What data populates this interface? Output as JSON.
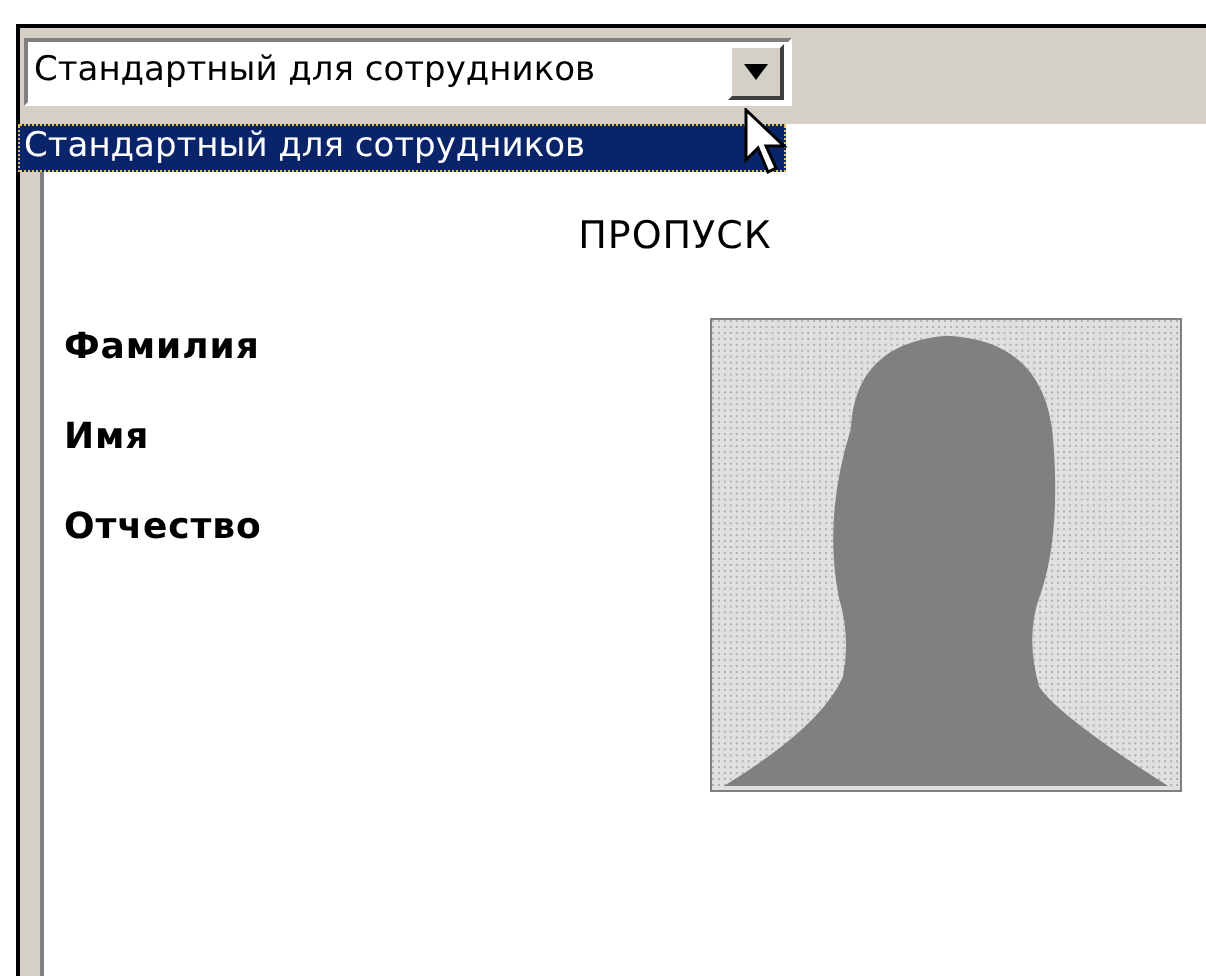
{
  "combo": {
    "value": "Стандартный для сотрудников",
    "options": [
      {
        "label": "Стандартный для сотрудников",
        "selected": true
      }
    ]
  },
  "card": {
    "title": "ПРОПУСК",
    "fields": [
      "Фамилия",
      "Имя",
      "Отчество"
    ]
  }
}
